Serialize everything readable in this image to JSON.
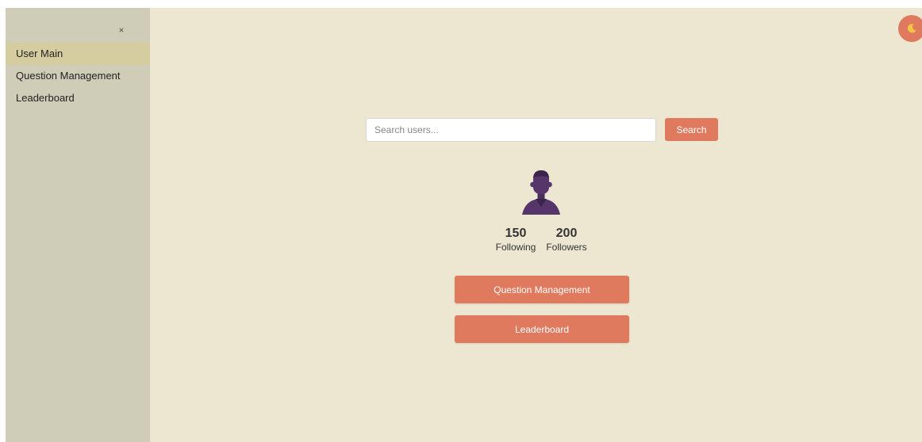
{
  "sidebar": {
    "close_label": "×",
    "items": [
      {
        "label": "User Main",
        "active": true
      },
      {
        "label": "Question Management",
        "active": false
      },
      {
        "label": "Leaderboard",
        "active": false
      }
    ]
  },
  "theme_toggle": {
    "icon": "moon-icon"
  },
  "search": {
    "placeholder": "Search users...",
    "value": "",
    "button_label": "Search"
  },
  "profile": {
    "avatar_icon": "user-avatar-icon",
    "following_count": "150",
    "following_label": "Following",
    "followers_count": "200",
    "followers_label": "Followers"
  },
  "actions": {
    "question_management_label": "Question Management",
    "leaderboard_label": "Leaderboard"
  },
  "colors": {
    "accent": "#e07a5f",
    "sidebar_bg": "#cfccb8",
    "sidebar_active": "#d5cc9f",
    "main_bg": "#ede7d1",
    "avatar": "#56356b"
  }
}
